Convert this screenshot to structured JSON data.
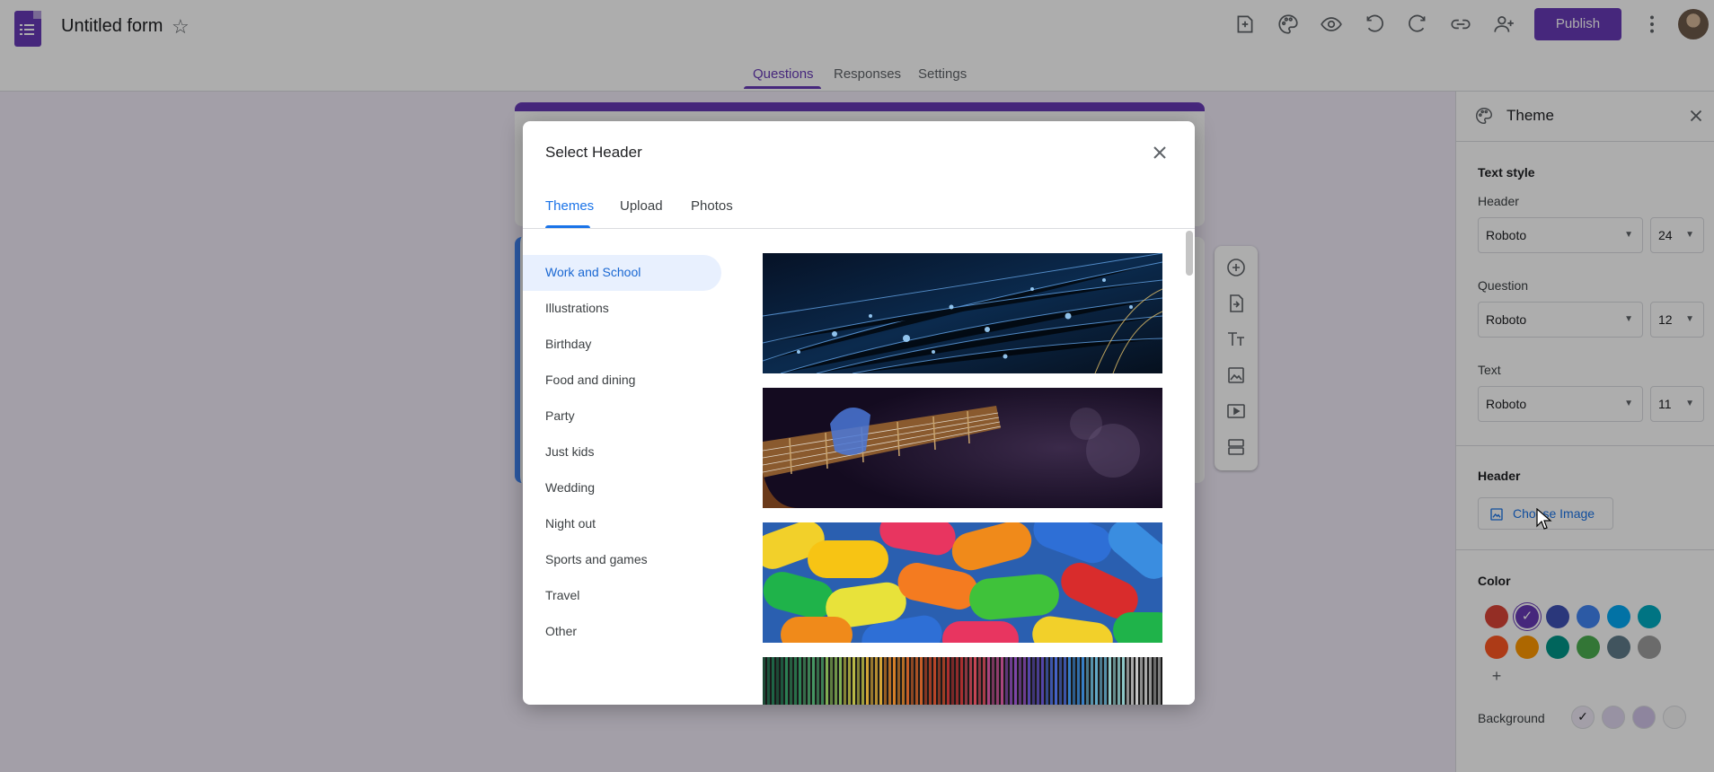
{
  "header": {
    "form_title": "Untitled form",
    "publish_label": "Publish",
    "toolbar_icons": [
      "customize-addons-icon",
      "palette-icon",
      "preview-eye-icon",
      "undo-icon",
      "redo-icon",
      "link-icon",
      "add-collaborator-icon",
      "more-vert-icon"
    ]
  },
  "tabs": {
    "questions": "Questions",
    "responses": "Responses",
    "settings": "Settings",
    "active": "Questions"
  },
  "theme_panel": {
    "title": "Theme",
    "text_style_heading": "Text style",
    "header_label": "Header",
    "header_font": "Roboto",
    "header_size": "24",
    "question_label": "Question",
    "question_font": "Roboto",
    "question_size": "12",
    "text_label": "Text",
    "text_font": "Roboto",
    "text_size": "11",
    "header_section": "Header",
    "choose_image": "Choose Image",
    "color_section": "Color",
    "background_label": "Background",
    "colors": [
      "#db4437",
      "#673ab7",
      "#3f51b5",
      "#4285f4",
      "#03a9f4",
      "#00acc1",
      "#ff5722",
      "#ff9800",
      "#009688",
      "#4caf50",
      "#607d8b",
      "#9e9e9e"
    ],
    "selected_color": "#673ab7",
    "backgrounds": [
      "#f0ebf8",
      "#e1d8f1",
      "#d1c4e9",
      "#f6f6f6"
    ],
    "selected_background": "#f0ebf8"
  },
  "modal": {
    "title": "Select Header",
    "tabs": [
      "Themes",
      "Upload",
      "Photos"
    ],
    "active_tab": "Themes",
    "categories": [
      "Work and School",
      "Illustrations",
      "Birthday",
      "Food and dining",
      "Party",
      "Just kids",
      "Wedding",
      "Night out",
      "Sports and games",
      "Travel",
      "Other"
    ],
    "active_category": "Work and School",
    "thumbnails": [
      "fiber-optic-lights-image",
      "guitar-player-image",
      "colorful-candy-image",
      "colorful-yarn-image"
    ]
  }
}
